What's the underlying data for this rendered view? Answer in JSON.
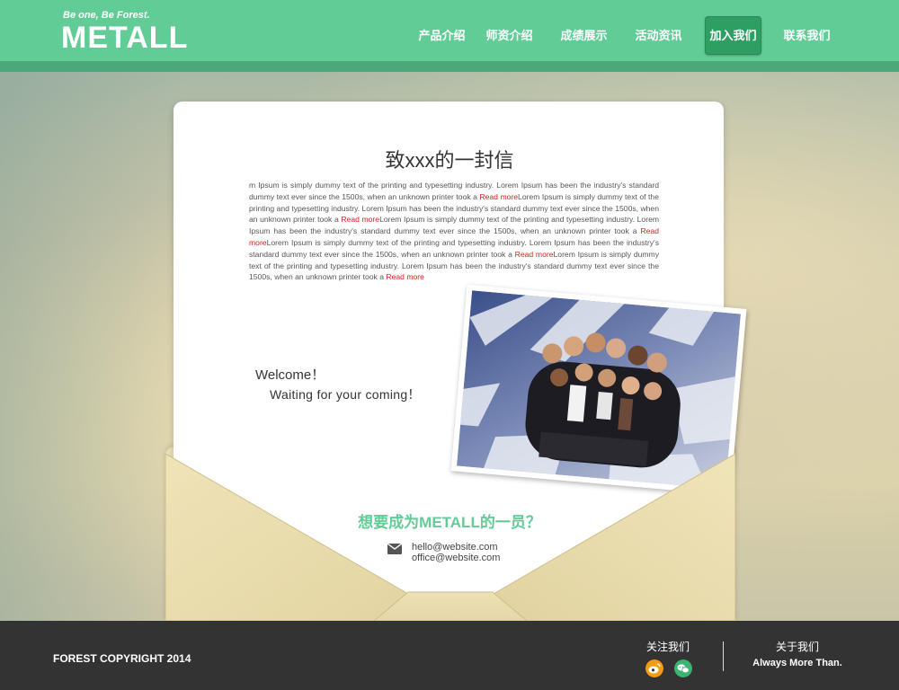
{
  "header": {
    "tagline": "Be one, Be Forest.",
    "logo": "METALL",
    "nav": [
      {
        "label": "产品介绍"
      },
      {
        "label": "师资介绍"
      },
      {
        "label": "成绩展示"
      },
      {
        "label": "活动资讯"
      },
      {
        "label": "加入我们",
        "active": true
      },
      {
        "label": "联系我们"
      }
    ]
  },
  "letter": {
    "title": "致xxx的一封信",
    "body_segments": [
      {
        "text": "m Ipsum is simply dummy text of the printing and typesetting industry. Lorem Ipsum has been the industry's standard dummy text ever since the 1500s, when an unknown printer took a "
      },
      {
        "text": "Read more",
        "link": true
      },
      {
        "text": "Lorem Ipsum is simply dummy text of the printing and typesetting industry. Lorem Ipsum has been the industry's standard dummy text ever since the 1500s, when an unknown printer took a "
      },
      {
        "text": "Read more",
        "link": true
      },
      {
        "text": "Lorem Ipsum is simply dummy text of the printing and typesetting industry. Lorem Ipsum has been the industry's standard dummy text ever since the 1500s, when an unknown printer took a "
      },
      {
        "text": "Read more",
        "link": true
      },
      {
        "text": "Lorem Ipsum is simply dummy text of the printing and typesetting industry. Lorem Ipsum has been the industry's standard dummy text ever since the 1500s, when an unknown printer took a "
      },
      {
        "text": "Read more",
        "link": true
      },
      {
        "text": "Lorem Ipsum is simply dummy text of the printing and typesetting industry. Lorem Ipsum has been the industry's standard dummy text ever since the 1500s, when an unknown printer took a "
      },
      {
        "text": "Read more",
        "link": true
      }
    ],
    "welcome": "Welcome！",
    "waiting": "Waiting for your coming！",
    "cta": "想要成为METALL的一员？",
    "emails": [
      "hello@website.com",
      "office@website.com"
    ]
  },
  "footer": {
    "copyright": "FOREST COPYRIGHT 2014",
    "follow_label": "关注我们",
    "about_label": "关于我们",
    "about_sub": "Always More Than.",
    "icons": [
      "weibo-icon",
      "wechat-icon"
    ]
  },
  "colors": {
    "brand_green": "#62cc97",
    "active_nav": "#2f9e62",
    "link_red": "#d0231f",
    "weibo_orange": "#f39c12",
    "wechat_green": "#3cb371"
  }
}
